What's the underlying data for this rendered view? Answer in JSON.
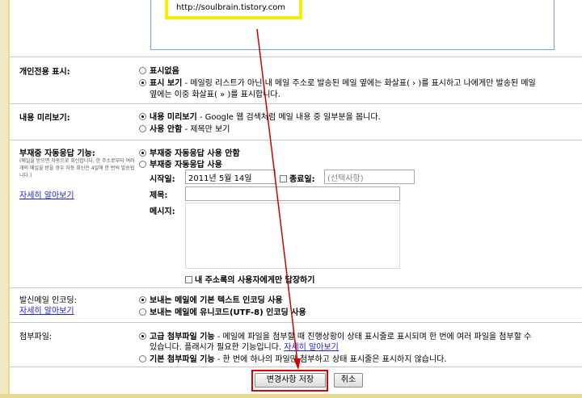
{
  "signature": {
    "url_text": "http://soulbrain.tistory.com"
  },
  "personal_indicator": {
    "label": "개인전용 표시:",
    "opt1": "표시없음",
    "opt2_bold": "표시 보기",
    "opt2_text": " - 메일링 리스트가 아닌 내 메일 주소로 발송된 메일 옆에는 화살표( › )를 표시하고 나에게만 발송된 메일",
    "opt2_line2": "옆에는 이중 화살표( » )를 표시합니다."
  },
  "snippets": {
    "label": "내용 미리보기:",
    "opt1_bold": "내용 미리보기",
    "opt1_text": " - Google 웹 검색처럼 메일 내용 중 일부분을 봅니다.",
    "opt2_bold": "사용 안함",
    "opt2_text": " - 제목만 보기"
  },
  "vacation": {
    "label": "부재중 자동응답 기능:",
    "note": "(메일을 받으면 자동으로 회신합니다. 한 주소로부터 여러 개의 메일을 받을 경우 자동 회신은 4일에 한 번씩 발송됩니다.)",
    "learn_more": "자세히 알아보기",
    "opt_off": "부재중 자동응답 사용 안함",
    "opt_on": "부재중 자동응답 사용",
    "start_label": "시작일:",
    "start_value": "2011년 5월 14일",
    "end_label": "종료일:",
    "end_placeholder": "(선택사항)",
    "subject_label": "제목:",
    "message_label": "메시지:",
    "contacts_only": "내 주소록의 사용자에게만 답장하기"
  },
  "encoding": {
    "label": "발신메일 인코딩:",
    "learn_more": "자세히 알아보기",
    "opt1": "보내는 메일에 기본 텍스트 인코딩 사용",
    "opt2": "보내는 메일에 유니코드(UTF-8) 인코딩 사용"
  },
  "attachments": {
    "label": "첨부파일:",
    "opt1_bold": "고급 첨부파일 기능",
    "opt1_text": " - 메일에 파일을 첨부할 때 진행상황이 상태 표시줄로 표시되며 한 번에 여러 파일을 첨부할 수",
    "opt1_line2": "있습니다. 플래시가 필요한 기능입니다.",
    "opt1_link": "자세히 알아보기",
    "opt2_bold": "기본 첨부파일 기능",
    "opt2_text": " - 한 번에 하나의 파일만 첨부하고 상태 표시줄은 표시하지 않습니다."
  },
  "buttons": {
    "save": "변경사항 저장",
    "cancel": "취소"
  },
  "annotation_colors": {
    "highlight": "#f5f000",
    "arrow": "#d00000"
  }
}
